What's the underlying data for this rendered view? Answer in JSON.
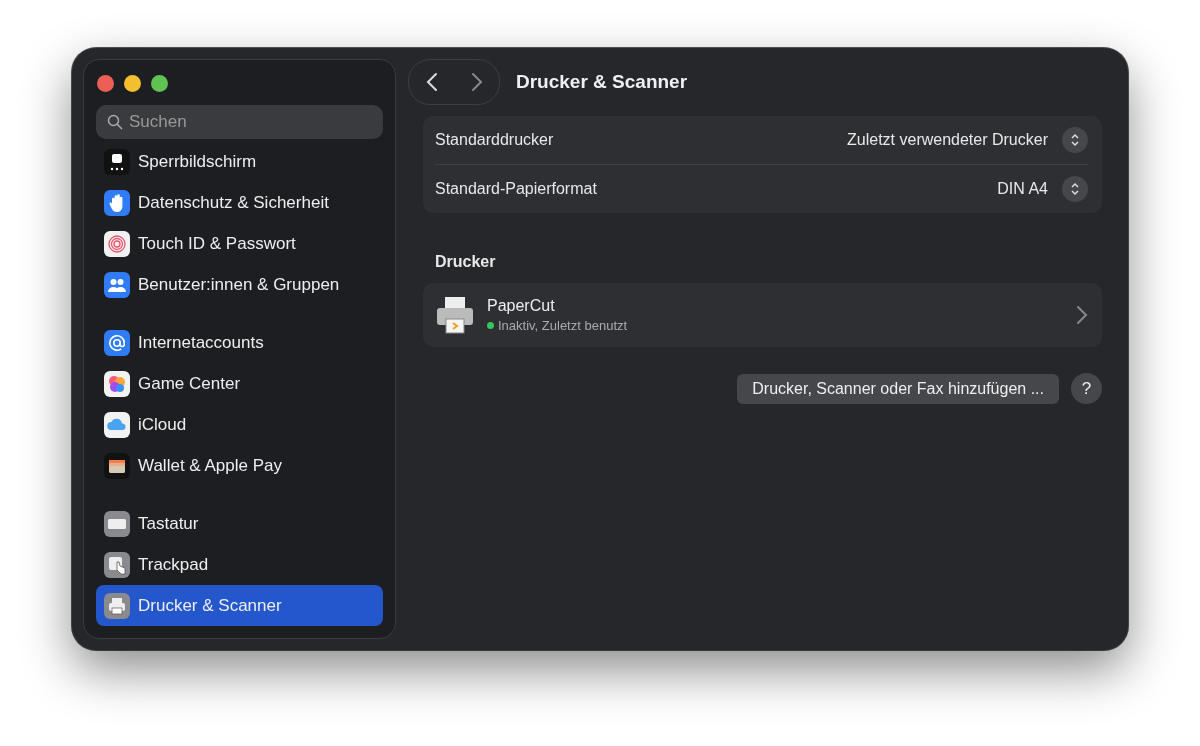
{
  "window": {
    "title": "Drucker & Scanner"
  },
  "sidebar": {
    "search": {
      "placeholder": "Suchen"
    },
    "groups": [
      [
        {
          "label": "Sperrbildschirm",
          "selected": false
        },
        {
          "label": "Datenschutz & Sicherheit",
          "selected": false
        },
        {
          "label": "Touch ID & Passwort",
          "selected": false
        },
        {
          "label": "Benutzer:innen & Gruppen",
          "selected": false
        }
      ],
      [
        {
          "label": "Internetaccounts",
          "selected": false
        },
        {
          "label": "Game Center",
          "selected": false
        },
        {
          "label": "iCloud",
          "selected": false
        },
        {
          "label": "Wallet & Apple Pay",
          "selected": false
        }
      ],
      [
        {
          "label": "Tastatur",
          "selected": false
        },
        {
          "label": "Trackpad",
          "selected": false
        },
        {
          "label": "Drucker & Scanner",
          "selected": true
        }
      ]
    ]
  },
  "settings": [
    {
      "label": "Standarddrucker",
      "value": "Zuletzt verwendeter Drucker"
    },
    {
      "label": "Standard-Papierformat",
      "value": "DIN A4"
    }
  ],
  "printers_section": {
    "title": "Drucker",
    "printers": [
      {
        "name": "PaperCut",
        "status": "Inaktiv, Zuletzt benutzt",
        "color": "#34c759"
      }
    ]
  },
  "add_button": "Drucker, Scanner oder Fax hinzufügen ...",
  "help_button": "?"
}
